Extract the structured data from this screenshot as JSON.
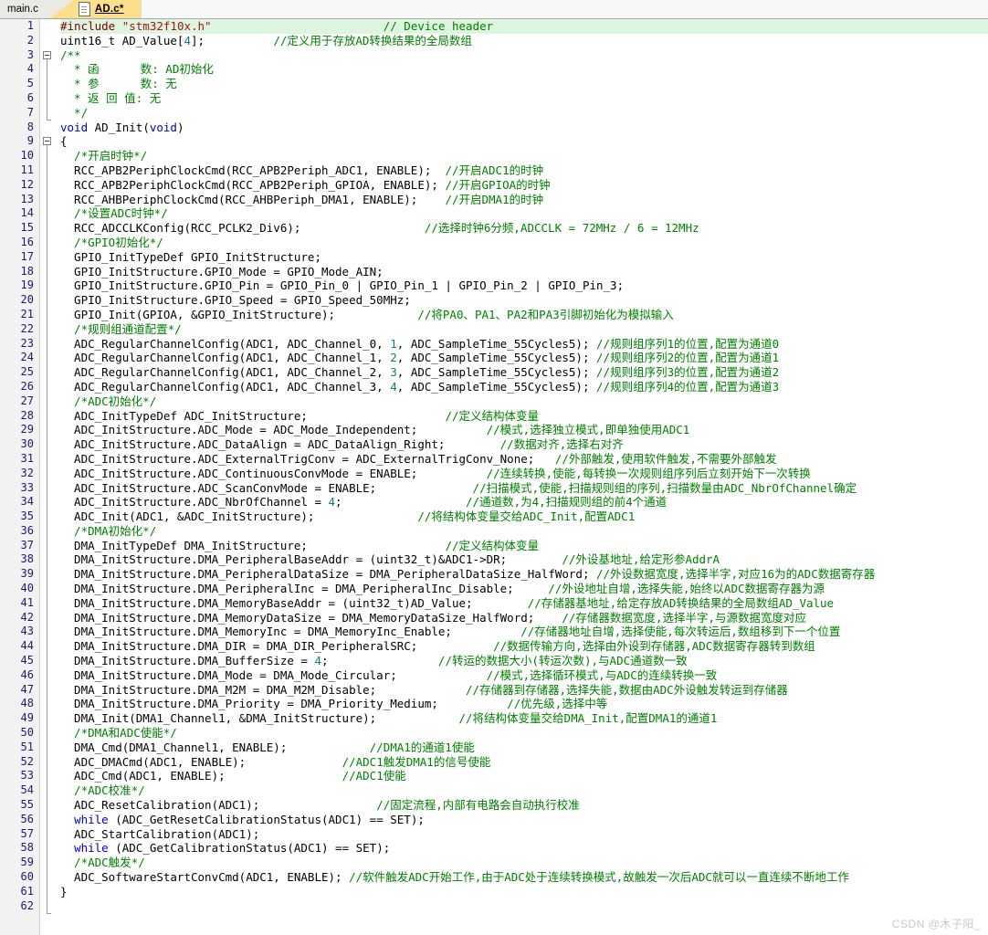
{
  "tabs": {
    "inactive_label": "main.c",
    "active_label": "AD.c*",
    "active_icon": "document-icon"
  },
  "watermark": "CSDN @木子阳_",
  "editor": {
    "total_lines": 62,
    "highlighted_line": 1,
    "fold_markers": [
      3,
      9
    ],
    "lines": [
      {
        "n": 1,
        "segments": [
          {
            "t": "#include ",
            "c": "pp-d"
          },
          {
            "t": "\"stm32f10x.h\"",
            "c": "str"
          },
          {
            "t": "                         ",
            "c": "plain"
          },
          {
            "t": "// Device header",
            "c": "cmt"
          }
        ]
      },
      {
        "n": 2,
        "segments": [
          {
            "t": "uint16_t AD_Value[",
            "c": "plain"
          },
          {
            "t": "4",
            "c": "num"
          },
          {
            "t": "];",
            "c": "plain"
          },
          {
            "t": "          ",
            "c": "plain"
          },
          {
            "t": "//定义用于存放AD转换结果的全局数组",
            "c": "cmt"
          }
        ]
      },
      {
        "n": 3,
        "segments": [
          {
            "t": "/**",
            "c": "cmt"
          }
        ]
      },
      {
        "n": 4,
        "segments": [
          {
            "t": "  * 函      数: AD初始化",
            "c": "cmt"
          }
        ]
      },
      {
        "n": 5,
        "segments": [
          {
            "t": "  * 参      数: 无",
            "c": "cmt"
          }
        ]
      },
      {
        "n": 6,
        "segments": [
          {
            "t": "  * 返 回 值: 无",
            "c": "cmt"
          }
        ]
      },
      {
        "n": 7,
        "segments": [
          {
            "t": "  */",
            "c": "cmt"
          }
        ]
      },
      {
        "n": 8,
        "segments": [
          {
            "t": "void",
            "c": "kw"
          },
          {
            "t": " AD_Init(",
            "c": "plain"
          },
          {
            "t": "void",
            "c": "kw"
          },
          {
            "t": ")",
            "c": "plain"
          }
        ]
      },
      {
        "n": 9,
        "segments": [
          {
            "t": "{",
            "c": "plain"
          }
        ]
      },
      {
        "n": 10,
        "segments": [
          {
            "t": "  /*开启时钟*/",
            "c": "cmt"
          }
        ]
      },
      {
        "n": 11,
        "segments": [
          {
            "t": "  RCC_APB2PeriphClockCmd(RCC_APB2Periph_ADC1, ENABLE);  ",
            "c": "plain"
          },
          {
            "t": "//开启ADC1的时钟",
            "c": "cmt"
          }
        ]
      },
      {
        "n": 12,
        "segments": [
          {
            "t": "  RCC_APB2PeriphClockCmd(RCC_APB2Periph_GPIOA, ENABLE); ",
            "c": "plain"
          },
          {
            "t": "//开启GPIOA的时钟",
            "c": "cmt"
          }
        ]
      },
      {
        "n": 13,
        "segments": [
          {
            "t": "  RCC_AHBPeriphClockCmd(RCC_AHBPeriph_DMA1, ENABLE);    ",
            "c": "plain"
          },
          {
            "t": "//开启DMA1的时钟",
            "c": "cmt"
          }
        ]
      },
      {
        "n": 14,
        "segments": [
          {
            "t": "  /*设置ADC时钟*/",
            "c": "cmt"
          }
        ]
      },
      {
        "n": 15,
        "segments": [
          {
            "t": "  RCC_ADCCLKConfig(RCC_PCLK2_Div6);                  ",
            "c": "plain"
          },
          {
            "t": "//选择时钟6分频,ADCCLK = 72MHz / 6 = 12MHz",
            "c": "cmt"
          }
        ]
      },
      {
        "n": 16,
        "segments": [
          {
            "t": "  /*GPIO初始化*/",
            "c": "cmt"
          }
        ]
      },
      {
        "n": 17,
        "segments": [
          {
            "t": "  GPIO_InitTypeDef GPIO_InitStructure;",
            "c": "plain"
          }
        ]
      },
      {
        "n": 18,
        "segments": [
          {
            "t": "  GPIO_InitStructure.GPIO_Mode = GPIO_Mode_AIN;",
            "c": "plain"
          }
        ]
      },
      {
        "n": 19,
        "segments": [
          {
            "t": "  GPIO_InitStructure.GPIO_Pin = GPIO_Pin_0 | GPIO_Pin_1 | GPIO_Pin_2 | GPIO_Pin_3;",
            "c": "plain"
          }
        ]
      },
      {
        "n": 20,
        "segments": [
          {
            "t": "  GPIO_InitStructure.GPIO_Speed = GPIO_Speed_50MHz;",
            "c": "plain"
          }
        ]
      },
      {
        "n": 21,
        "segments": [
          {
            "t": "  GPIO_Init(GPIOA, &GPIO_InitStructure);            ",
            "c": "plain"
          },
          {
            "t": "//将PA0、PA1、PA2和PA3引脚初始化为模拟输入",
            "c": "cmt"
          }
        ]
      },
      {
        "n": 22,
        "segments": [
          {
            "t": "  /*规则组通道配置*/",
            "c": "cmt"
          }
        ]
      },
      {
        "n": 23,
        "segments": [
          {
            "t": "  ADC_RegularChannelConfig(ADC1, ADC_Channel_0, ",
            "c": "plain"
          },
          {
            "t": "1",
            "c": "num"
          },
          {
            "t": ", ADC_SampleTime_55Cycles5); ",
            "c": "plain"
          },
          {
            "t": "//规则组序列1的位置,配置为通道0",
            "c": "cmt"
          }
        ]
      },
      {
        "n": 24,
        "segments": [
          {
            "t": "  ADC_RegularChannelConfig(ADC1, ADC_Channel_1, ",
            "c": "plain"
          },
          {
            "t": "2",
            "c": "num"
          },
          {
            "t": ", ADC_SampleTime_55Cycles5); ",
            "c": "plain"
          },
          {
            "t": "//规则组序列2的位置,配置为通道1",
            "c": "cmt"
          }
        ]
      },
      {
        "n": 25,
        "segments": [
          {
            "t": "  ADC_RegularChannelConfig(ADC1, ADC_Channel_2, ",
            "c": "plain"
          },
          {
            "t": "3",
            "c": "num"
          },
          {
            "t": ", ADC_SampleTime_55Cycles5); ",
            "c": "plain"
          },
          {
            "t": "//规则组序列3的位置,配置为通道2",
            "c": "cmt"
          }
        ]
      },
      {
        "n": 26,
        "segments": [
          {
            "t": "  ADC_RegularChannelConfig(ADC1, ADC_Channel_3, ",
            "c": "plain"
          },
          {
            "t": "4",
            "c": "num"
          },
          {
            "t": ", ADC_SampleTime_55Cycles5); ",
            "c": "plain"
          },
          {
            "t": "//规则组序列4的位置,配置为通道3",
            "c": "cmt"
          }
        ]
      },
      {
        "n": 27,
        "segments": [
          {
            "t": "  /*ADC初始化*/",
            "c": "cmt"
          }
        ]
      },
      {
        "n": 28,
        "segments": [
          {
            "t": "  ADC_InitTypeDef ADC_InitStructure;                    ",
            "c": "plain"
          },
          {
            "t": "//定义结构体变量",
            "c": "cmt"
          }
        ]
      },
      {
        "n": 29,
        "segments": [
          {
            "t": "  ADC_InitStructure.ADC_Mode = ADC_Mode_Independent;          ",
            "c": "plain"
          },
          {
            "t": "//模式,选择独立模式,即单独使用ADC1",
            "c": "cmt"
          }
        ]
      },
      {
        "n": 30,
        "segments": [
          {
            "t": "  ADC_InitStructure.ADC_DataAlign = ADC_DataAlign_Right;        ",
            "c": "plain"
          },
          {
            "t": "//数据对齐,选择右对齐",
            "c": "cmt"
          }
        ]
      },
      {
        "n": 31,
        "segments": [
          {
            "t": "  ADC_InitStructure.ADC_ExternalTrigConv = ADC_ExternalTrigConv_None;   ",
            "c": "plain"
          },
          {
            "t": "//外部触发,使用软件触发,不需要外部触发",
            "c": "cmt"
          }
        ]
      },
      {
        "n": 32,
        "segments": [
          {
            "t": "  ADC_InitStructure.ADC_ContinuousConvMode = ENABLE;          ",
            "c": "plain"
          },
          {
            "t": "//连续转换,使能,每转换一次规则组序列后立刻开始下一次转换",
            "c": "cmt"
          }
        ]
      },
      {
        "n": 33,
        "segments": [
          {
            "t": "  ADC_InitStructure.ADC_ScanConvMode = ENABLE;              ",
            "c": "plain"
          },
          {
            "t": "//扫描模式,使能,扫描规则组的序列,扫描数量由ADC_NbrOfChannel确定",
            "c": "cmt"
          }
        ]
      },
      {
        "n": 34,
        "segments": [
          {
            "t": "  ADC_InitStructure.ADC_NbrOfChannel = ",
            "c": "plain"
          },
          {
            "t": "4",
            "c": "num"
          },
          {
            "t": ";                  ",
            "c": "plain"
          },
          {
            "t": "//通道数,为4,扫描规则组的前4个通道",
            "c": "cmt"
          }
        ]
      },
      {
        "n": 35,
        "segments": [
          {
            "t": "  ADC_Init(ADC1, &ADC_InitStructure);               ",
            "c": "plain"
          },
          {
            "t": "//将结构体变量交给ADC_Init,配置ADC1",
            "c": "cmt"
          }
        ]
      },
      {
        "n": 36,
        "segments": [
          {
            "t": "  /*DMA初始化*/",
            "c": "cmt"
          }
        ]
      },
      {
        "n": 37,
        "segments": [
          {
            "t": "  DMA_InitTypeDef DMA_InitStructure;                    ",
            "c": "plain"
          },
          {
            "t": "//定义结构体变量",
            "c": "cmt"
          }
        ]
      },
      {
        "n": 38,
        "segments": [
          {
            "t": "  DMA_InitStructure.DMA_PeripheralBaseAddr = (uint32_t)&ADC1->DR;        ",
            "c": "plain"
          },
          {
            "t": "//外设基地址,给定形参AddrA",
            "c": "cmt"
          }
        ]
      },
      {
        "n": 39,
        "segments": [
          {
            "t": "  DMA_InitStructure.DMA_PeripheralDataSize = DMA_PeripheralDataSize_HalfWord; ",
            "c": "plain"
          },
          {
            "t": "//外设数据宽度,选择半字,对应16为的ADC数据寄存器",
            "c": "cmt"
          }
        ]
      },
      {
        "n": 40,
        "segments": [
          {
            "t": "  DMA_InitStructure.DMA_PeripheralInc = DMA_PeripheralInc_Disable;     ",
            "c": "plain"
          },
          {
            "t": "//外设地址自增,选择失能,始终以ADC数据寄存器为源",
            "c": "cmt"
          }
        ]
      },
      {
        "n": 41,
        "segments": [
          {
            "t": "  DMA_InitStructure.DMA_MemoryBaseAddr = (uint32_t)AD_Value;        ",
            "c": "plain"
          },
          {
            "t": "//存储器基地址,给定存放AD转换结果的全局数组AD_Value",
            "c": "cmt"
          }
        ]
      },
      {
        "n": 42,
        "segments": [
          {
            "t": "  DMA_InitStructure.DMA_MemoryDataSize = DMA_MemoryDataSize_HalfWord;    ",
            "c": "plain"
          },
          {
            "t": "//存储器数据宽度,选择半字,与源数据宽度对应",
            "c": "cmt"
          }
        ]
      },
      {
        "n": 43,
        "segments": [
          {
            "t": "  DMA_InitStructure.DMA_MemoryInc = DMA_MemoryInc_Enable;          ",
            "c": "plain"
          },
          {
            "t": "//存储器地址自增,选择使能,每次转运后,数组移到下一个位置",
            "c": "cmt"
          }
        ]
      },
      {
        "n": 44,
        "segments": [
          {
            "t": "  DMA_InitStructure.DMA_DIR = DMA_DIR_PeripheralSRC;           ",
            "c": "plain"
          },
          {
            "t": "//数据传输方向,选择由外设到存储器,ADC数据寄存器转到数组",
            "c": "cmt"
          }
        ]
      },
      {
        "n": 45,
        "segments": [
          {
            "t": "  DMA_InitStructure.DMA_BufferSize = ",
            "c": "plain"
          },
          {
            "t": "4",
            "c": "num"
          },
          {
            "t": ";                ",
            "c": "plain"
          },
          {
            "t": "//转运的数据大小(转运次数),与ADC通道数一致",
            "c": "cmt"
          }
        ]
      },
      {
        "n": 46,
        "segments": [
          {
            "t": "  DMA_InitStructure.DMA_Mode = DMA_Mode_Circular;             ",
            "c": "plain"
          },
          {
            "t": "//模式,选择循环模式,与ADC的连续转换一致",
            "c": "cmt"
          }
        ]
      },
      {
        "n": 47,
        "segments": [
          {
            "t": "  DMA_InitStructure.DMA_M2M = DMA_M2M_Disable;             ",
            "c": "plain"
          },
          {
            "t": "//存储器到存储器,选择失能,数据由ADC外设触发转运到存储器",
            "c": "cmt"
          }
        ]
      },
      {
        "n": 48,
        "segments": [
          {
            "t": "  DMA_InitStructure.DMA_Priority = DMA_Priority_Medium;          ",
            "c": "plain"
          },
          {
            "t": "//优先级,选择中等",
            "c": "cmt"
          }
        ]
      },
      {
        "n": 49,
        "segments": [
          {
            "t": "  DMA_Init(DMA1_Channel1, &DMA_InitStructure);            ",
            "c": "plain"
          },
          {
            "t": "//将结构体变量交给DMA_Init,配置DMA1的通道1",
            "c": "cmt"
          }
        ]
      },
      {
        "n": 50,
        "segments": [
          {
            "t": "  /*DMA和ADC使能*/",
            "c": "cmt"
          }
        ]
      },
      {
        "n": 51,
        "segments": [
          {
            "t": "  DMA_Cmd(DMA1_Channel1, ENABLE);            ",
            "c": "plain"
          },
          {
            "t": "//DMA1的通道1使能",
            "c": "cmt"
          }
        ]
      },
      {
        "n": 52,
        "segments": [
          {
            "t": "  ADC_DMACmd(ADC1, ENABLE);              ",
            "c": "plain"
          },
          {
            "t": "//ADC1触发DMA1的信号使能",
            "c": "cmt"
          }
        ]
      },
      {
        "n": 53,
        "segments": [
          {
            "t": "  ADC_Cmd(ADC1, ENABLE);                 ",
            "c": "plain"
          },
          {
            "t": "//ADC1使能",
            "c": "cmt"
          }
        ]
      },
      {
        "n": 54,
        "segments": [
          {
            "t": "  /*ADC校准*/",
            "c": "cmt"
          }
        ]
      },
      {
        "n": 55,
        "segments": [
          {
            "t": "  ADC_ResetCalibration(ADC1);                 ",
            "c": "plain"
          },
          {
            "t": "//固定流程,内部有电路会自动执行校准",
            "c": "cmt"
          }
        ]
      },
      {
        "n": 56,
        "segments": [
          {
            "t": "  ",
            "c": "plain"
          },
          {
            "t": "while",
            "c": "kw"
          },
          {
            "t": " (ADC_GetResetCalibrationStatus(ADC1) == SET);",
            "c": "plain"
          }
        ]
      },
      {
        "n": 57,
        "segments": [
          {
            "t": "  ADC_StartCalibration(ADC1);",
            "c": "plain"
          }
        ]
      },
      {
        "n": 58,
        "segments": [
          {
            "t": "  ",
            "c": "plain"
          },
          {
            "t": "while",
            "c": "kw"
          },
          {
            "t": " (ADC_GetCalibrationStatus(ADC1) == SET);",
            "c": "plain"
          }
        ]
      },
      {
        "n": 59,
        "segments": [
          {
            "t": "  /*ADC触发*/",
            "c": "cmt"
          }
        ]
      },
      {
        "n": 60,
        "segments": [
          {
            "t": "  ADC_SoftwareStartConvCmd(ADC1, ENABLE); ",
            "c": "plain"
          },
          {
            "t": "//软件触发ADC开始工作,由于ADC处于连续转换模式,故触发一次后ADC就可以一直连续不断地工作",
            "c": "cmt"
          }
        ]
      },
      {
        "n": 61,
        "segments": [
          {
            "t": "}",
            "c": "plain"
          }
        ]
      },
      {
        "n": 62,
        "segments": [
          {
            "t": "",
            "c": "plain"
          }
        ]
      }
    ]
  }
}
